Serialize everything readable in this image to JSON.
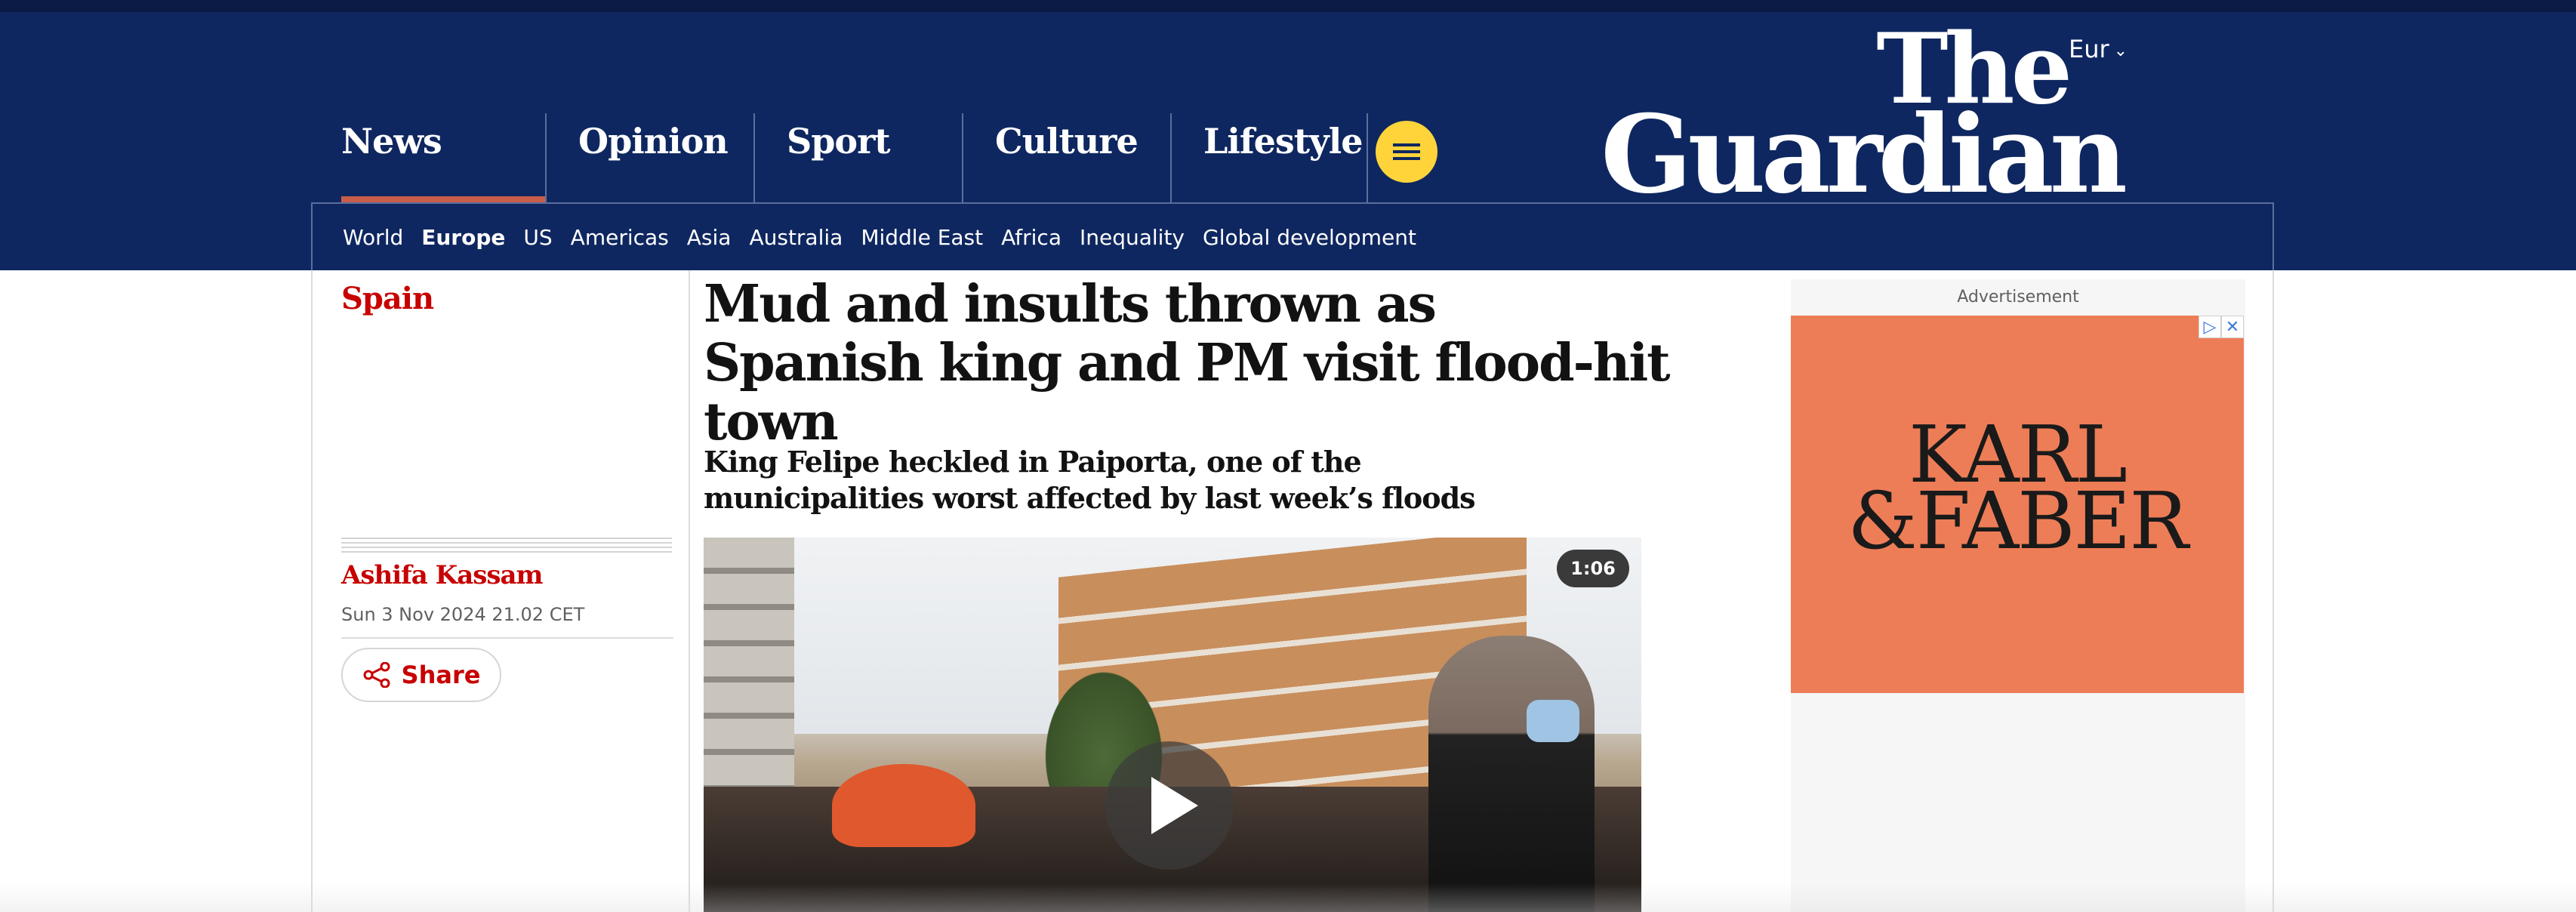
{
  "header": {
    "edition": "Eur",
    "logo_line1": "The",
    "logo_line2": "Guardian",
    "pillars": [
      "News",
      "Opinion",
      "Sport",
      "Culture",
      "Lifestyle"
    ],
    "active_pillar": "News",
    "subnav": [
      "World",
      "Europe",
      "US",
      "Americas",
      "Asia",
      "Australia",
      "Middle East",
      "Africa",
      "Inequality",
      "Global development"
    ],
    "subnav_active": "Europe"
  },
  "article": {
    "section": "Spain",
    "headline": "Mud and insults thrown as Spanish king and PM visit flood-hit town",
    "standfirst": "King Felipe heckled in Paiporta, one of the municipalities worst affected by last week’s floods",
    "author": "Ashifa Kassam",
    "date": "Sun 3 Nov 2024 21.02 CET",
    "share_label": "Share",
    "video_duration": "1:06"
  },
  "advert": {
    "label": "Advertisement",
    "brand_line1": "KARL",
    "brand_line2": "&FABER"
  },
  "colors": {
    "masthead": "#0f2760",
    "accent_red": "#c70000",
    "menu_yellow": "#ffd43b",
    "ad_orange": "#ed7d57"
  },
  "icons": {
    "menu": "hamburger-icon",
    "share": "share-icon",
    "play": "play-icon",
    "chevron": "chevron-down-icon",
    "adchoices": "adchoices-icon",
    "close": "close-icon"
  }
}
